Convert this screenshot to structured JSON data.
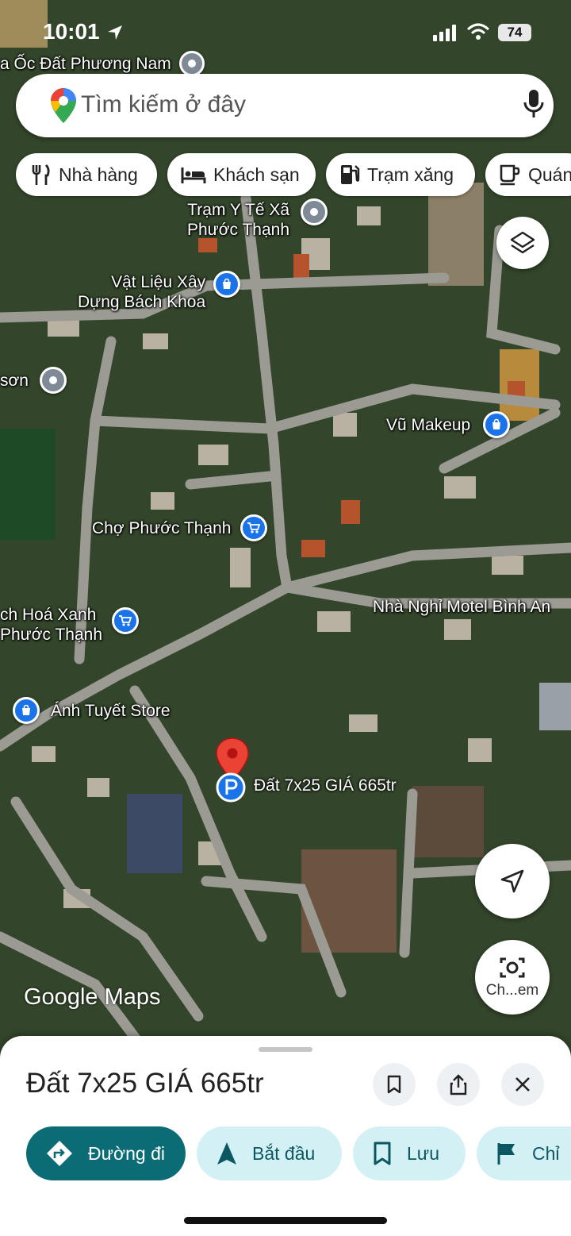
{
  "status_bar": {
    "time": "10:01",
    "battery": "74"
  },
  "search": {
    "placeholder": "Tìm kiếm ở đây"
  },
  "chips": [
    {
      "label": "Nhà hàng",
      "icon": "restaurant-icon"
    },
    {
      "label": "Khách sạn",
      "icon": "hotel-icon"
    },
    {
      "label": "Trạm xăng",
      "icon": "gas-station-icon"
    },
    {
      "label": "Quán",
      "icon": "cafe-icon"
    }
  ],
  "map": {
    "pois": [
      {
        "label": "a Ốc Đất Phương Nam",
        "pin": "grey"
      },
      {
        "label": "Trạm Y Tế Xã\nPhước Thạnh",
        "pin": "grey"
      },
      {
        "label": "Vật Liệu Xây\nDựng Bách Khoa",
        "pin": "blue-shopping"
      },
      {
        "label": "sơn",
        "pin": "grey"
      },
      {
        "label": "Vũ Makeup",
        "pin": "blue-shopping"
      },
      {
        "label": "Chợ Phước Thạnh",
        "pin": "blue-cart"
      },
      {
        "label": "ch Hoá Xanh\nPhước Thạnh",
        "pin": "blue-cart"
      },
      {
        "label": "Nhà Nghỉ Motel Bình An",
        "pin": "none"
      },
      {
        "label": "Ánh Tuyết Store",
        "pin": "blue-shopping"
      }
    ],
    "selected_place_label": "Đất 7x25 GIÁ 665tr",
    "lens_label": "Ch...em",
    "wordmark": "Google Maps"
  },
  "sheet": {
    "title": "Đất 7x25 GIÁ 665tr",
    "actions": [
      {
        "label": "Đường đi",
        "icon": "directions-icon"
      },
      {
        "label": "Bắt đầu",
        "icon": "navigation-arrow-icon"
      },
      {
        "label": "Lưu",
        "icon": "bookmark-icon"
      },
      {
        "label": "Chỉ",
        "icon": "flag-icon"
      }
    ]
  },
  "colors": {
    "primary": "#0b6c75",
    "secondary_pill": "#d3f1f5",
    "pin_red": "#ea4335",
    "poi_blue": "#1a73e8"
  }
}
